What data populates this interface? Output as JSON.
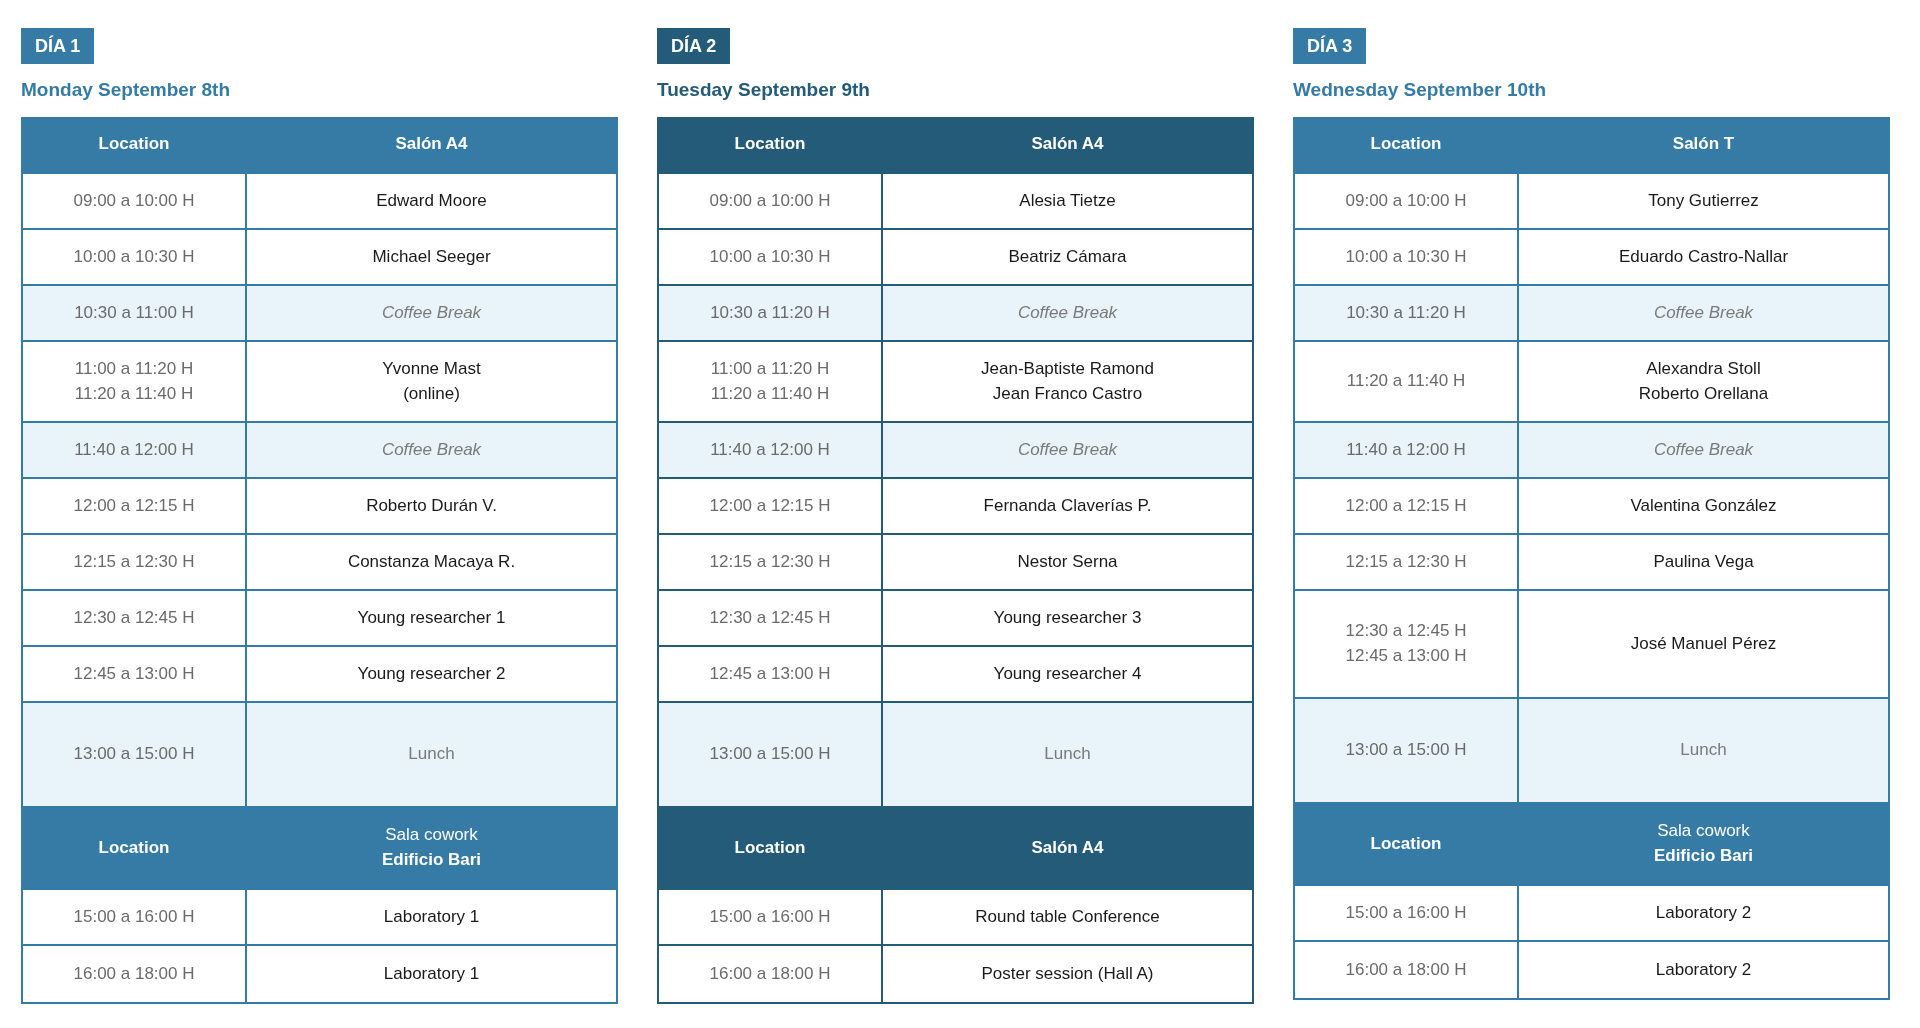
{
  "days": [
    {
      "badge": "DÍA 1",
      "date": "Monday September 8th",
      "color": "#357ba6",
      "rows": [
        {
          "kind": "header",
          "location": "Location",
          "venue": [
            {
              "text": "Salón A4",
              "bold": true
            }
          ]
        },
        {
          "kind": "session",
          "times": [
            "09:00 a 10:00 H"
          ],
          "names": [
            "Edward Moore"
          ]
        },
        {
          "kind": "session",
          "times": [
            "10:00 a 10:30 H"
          ],
          "names": [
            "Michael Seeger"
          ]
        },
        {
          "kind": "break",
          "times": [
            "10:30 a 11:00 H"
          ],
          "names": [
            "Coffee Break"
          ]
        },
        {
          "kind": "session",
          "times": [
            "11:00 a 11:20 H",
            "11:20 a 11:40 H"
          ],
          "names": [
            "Yvonne Mast",
            "(online)"
          ]
        },
        {
          "kind": "break",
          "times": [
            "11:40 a 12:00 H"
          ],
          "names": [
            "Coffee Break"
          ]
        },
        {
          "kind": "session",
          "times": [
            "12:00 a 12:15 H"
          ],
          "names": [
            "Roberto Durán V."
          ]
        },
        {
          "kind": "session",
          "times": [
            "12:15 a 12:30 H"
          ],
          "names": [
            "Constanza Macaya R."
          ]
        },
        {
          "kind": "session",
          "times": [
            "12:30 a 12:45 H"
          ],
          "names": [
            "Young researcher 1"
          ]
        },
        {
          "kind": "session",
          "times": [
            "12:45 a 13:00 H"
          ],
          "names": [
            "Young researcher 2"
          ]
        },
        {
          "kind": "meal",
          "times": [
            "13:00 a 15:00 H"
          ],
          "names": [
            "Lunch"
          ]
        },
        {
          "kind": "header",
          "location": "Location",
          "venue": [
            {
              "text": "Sala cowork",
              "bold": false
            },
            {
              "text": "Edificio Bari",
              "bold": true
            }
          ]
        },
        {
          "kind": "session",
          "times": [
            "15:00 a 16:00 H"
          ],
          "names": [
            "Laboratory 1"
          ]
        },
        {
          "kind": "session",
          "times": [
            "16:00 a 18:00 H"
          ],
          "names": [
            "Laboratory 1"
          ]
        }
      ]
    },
    {
      "badge": "DÍA 2",
      "date": "Tuesday September 9th",
      "color": "#245b78",
      "rows": [
        {
          "kind": "header",
          "location": "Location",
          "venue": [
            {
              "text": "Salón A4",
              "bold": true
            }
          ]
        },
        {
          "kind": "session",
          "times": [
            "09:00 a 10:00 H"
          ],
          "names": [
            "Alesia Tietze"
          ]
        },
        {
          "kind": "session",
          "times": [
            "10:00 a 10:30 H"
          ],
          "names": [
            "Beatriz Cámara"
          ]
        },
        {
          "kind": "break",
          "times": [
            "10:30 a 11:20 H"
          ],
          "names": [
            "Coffee Break"
          ]
        },
        {
          "kind": "session",
          "times": [
            "11:00 a 11:20 H",
            "11:20 a 11:40 H"
          ],
          "names": [
            "Jean-Baptiste Ramond",
            "Jean Franco Castro"
          ]
        },
        {
          "kind": "break",
          "times": [
            "11:40 a 12:00 H"
          ],
          "names": [
            "Coffee Break"
          ]
        },
        {
          "kind": "session",
          "times": [
            "12:00 a 12:15 H"
          ],
          "names": [
            "Fernanda Claverías P."
          ]
        },
        {
          "kind": "session",
          "times": [
            "12:15 a 12:30 H"
          ],
          "names": [
            "Nestor Serna"
          ]
        },
        {
          "kind": "session",
          "times": [
            "12:30 a 12:45 H"
          ],
          "names": [
            "Young researcher 3"
          ]
        },
        {
          "kind": "session",
          "times": [
            "12:45 a 13:00 H"
          ],
          "names": [
            "Young researcher 4"
          ]
        },
        {
          "kind": "meal",
          "times": [
            "13:00 a 15:00 H"
          ],
          "names": [
            "Lunch"
          ]
        },
        {
          "kind": "header",
          "location": "Location",
          "venue": [
            {
              "text": "Salón A4",
              "bold": true
            }
          ]
        },
        {
          "kind": "session",
          "times": [
            "15:00 a 16:00 H"
          ],
          "names": [
            "Round table Conference"
          ]
        },
        {
          "kind": "session",
          "times": [
            "16:00 a 18:00 H"
          ],
          "names": [
            "Poster session (Hall A)"
          ]
        }
      ]
    },
    {
      "badge": "DÍA 3",
      "date": "Wednesday September 10th",
      "color": "#357ba6",
      "rows": [
        {
          "kind": "header",
          "location": "Location",
          "venue": [
            {
              "text": "Salón T",
              "bold": true
            }
          ]
        },
        {
          "kind": "session",
          "times": [
            "09:00 a 10:00 H"
          ],
          "names": [
            "Tony Gutierrez"
          ]
        },
        {
          "kind": "session",
          "times": [
            "10:00 a 10:30 H"
          ],
          "names": [
            "Eduardo Castro-Nallar"
          ]
        },
        {
          "kind": "break",
          "times": [
            "10:30 a 11:20 H"
          ],
          "names": [
            "Coffee Break"
          ]
        },
        {
          "kind": "session",
          "times": [
            "11:20 a 11:40 H"
          ],
          "names": [
            "Alexandra Stoll",
            "Roberto Orellana"
          ]
        },
        {
          "kind": "break",
          "times": [
            "11:40 a 12:00 H"
          ],
          "names": [
            "Coffee Break"
          ]
        },
        {
          "kind": "session",
          "times": [
            "12:00 a 12:15 H"
          ],
          "names": [
            "Valentina González"
          ]
        },
        {
          "kind": "session",
          "times": [
            "12:15 a 12:30 H"
          ],
          "names": [
            "Paulina Vega"
          ]
        },
        {
          "kind": "session",
          "times": [
            "12:30 a 12:45 H",
            "12:45 a 13:00 H"
          ],
          "names": [
            "José Manuel Pérez"
          ]
        },
        {
          "kind": "meal",
          "times": [
            "13:00 a 15:00 H"
          ],
          "names": [
            "Lunch"
          ]
        },
        {
          "kind": "header",
          "location": "Location",
          "venue": [
            {
              "text": "Sala cowork",
              "bold": false
            },
            {
              "text": "Edificio Bari",
              "bold": true
            }
          ]
        },
        {
          "kind": "session",
          "times": [
            "15:00 a 16:00 H"
          ],
          "names": [
            "Laboratory 2"
          ]
        },
        {
          "kind": "session",
          "times": [
            "16:00 a 18:00 H"
          ],
          "names": [
            "Laboratory 2"
          ]
        }
      ]
    }
  ]
}
